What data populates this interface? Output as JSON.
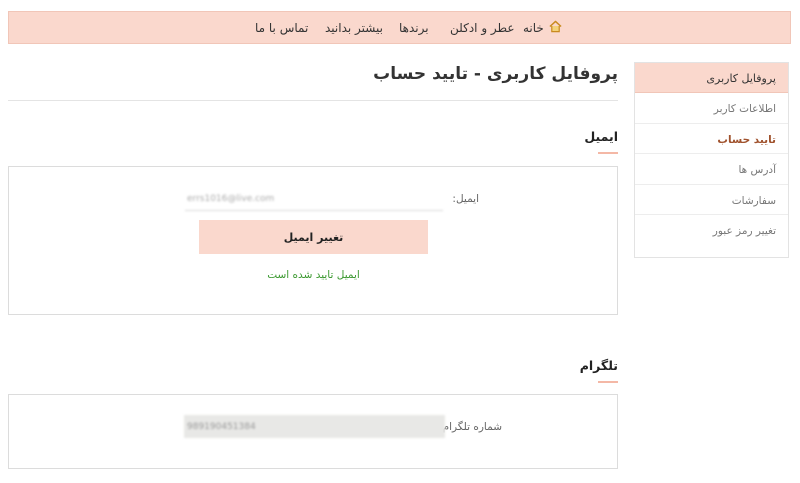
{
  "nav": {
    "home": "خانه",
    "perfume": "عطر و ادکلن",
    "brands": "برندها",
    "more": "بیشتر بدانید",
    "contact": "تماس با ما",
    "home_icon": "home-icon"
  },
  "sidebar": {
    "header": "پروفایل کاربری",
    "items": [
      {
        "label": "اطلاعات کاربر"
      },
      {
        "label": "تایید حساب"
      },
      {
        "label": "آدرس ها"
      },
      {
        "label": "سفارشات"
      },
      {
        "label": "تغییر رمز عبور"
      }
    ],
    "active_index": 1
  },
  "main": {
    "title": "پروفایل کاربری - تایید حساب",
    "email_section": {
      "heading": "ایمیل",
      "label": "ایمیل:",
      "value": "errs1016@live.com",
      "button": "تغییر ایمیل",
      "status": "ایمیل تایید شده است"
    },
    "telegram_section": {
      "heading": "تلگرام",
      "label": "شماره تلگرام:",
      "value": "989190451384"
    }
  },
  "colors": {
    "accent": "#fad8cd",
    "active_link": "#a0522d",
    "success": "#3d9a32"
  }
}
